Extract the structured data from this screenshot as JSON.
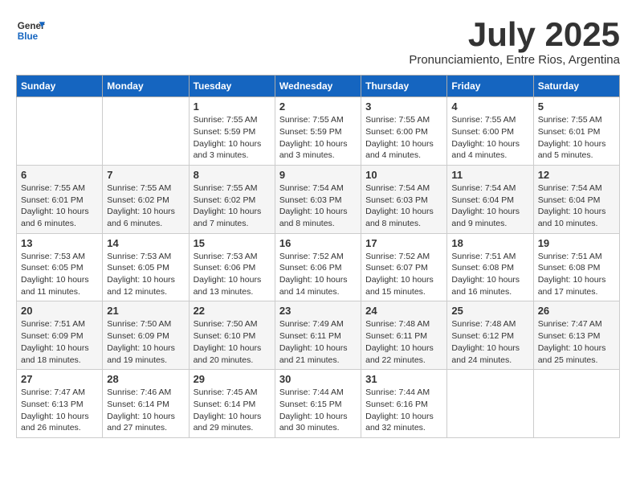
{
  "header": {
    "logo_line1": "General",
    "logo_line2": "Blue",
    "month_title": "July 2025",
    "subtitle": "Pronunciamiento, Entre Rios, Argentina"
  },
  "weekdays": [
    "Sunday",
    "Monday",
    "Tuesday",
    "Wednesday",
    "Thursday",
    "Friday",
    "Saturday"
  ],
  "weeks": [
    [
      {
        "day": "",
        "info": ""
      },
      {
        "day": "",
        "info": ""
      },
      {
        "day": "1",
        "info": "Sunrise: 7:55 AM\nSunset: 5:59 PM\nDaylight: 10 hours and 3 minutes."
      },
      {
        "day": "2",
        "info": "Sunrise: 7:55 AM\nSunset: 5:59 PM\nDaylight: 10 hours and 3 minutes."
      },
      {
        "day": "3",
        "info": "Sunrise: 7:55 AM\nSunset: 6:00 PM\nDaylight: 10 hours and 4 minutes."
      },
      {
        "day": "4",
        "info": "Sunrise: 7:55 AM\nSunset: 6:00 PM\nDaylight: 10 hours and 4 minutes."
      },
      {
        "day": "5",
        "info": "Sunrise: 7:55 AM\nSunset: 6:01 PM\nDaylight: 10 hours and 5 minutes."
      }
    ],
    [
      {
        "day": "6",
        "info": "Sunrise: 7:55 AM\nSunset: 6:01 PM\nDaylight: 10 hours and 6 minutes."
      },
      {
        "day": "7",
        "info": "Sunrise: 7:55 AM\nSunset: 6:02 PM\nDaylight: 10 hours and 6 minutes."
      },
      {
        "day": "8",
        "info": "Sunrise: 7:55 AM\nSunset: 6:02 PM\nDaylight: 10 hours and 7 minutes."
      },
      {
        "day": "9",
        "info": "Sunrise: 7:54 AM\nSunset: 6:03 PM\nDaylight: 10 hours and 8 minutes."
      },
      {
        "day": "10",
        "info": "Sunrise: 7:54 AM\nSunset: 6:03 PM\nDaylight: 10 hours and 8 minutes."
      },
      {
        "day": "11",
        "info": "Sunrise: 7:54 AM\nSunset: 6:04 PM\nDaylight: 10 hours and 9 minutes."
      },
      {
        "day": "12",
        "info": "Sunrise: 7:54 AM\nSunset: 6:04 PM\nDaylight: 10 hours and 10 minutes."
      }
    ],
    [
      {
        "day": "13",
        "info": "Sunrise: 7:53 AM\nSunset: 6:05 PM\nDaylight: 10 hours and 11 minutes."
      },
      {
        "day": "14",
        "info": "Sunrise: 7:53 AM\nSunset: 6:05 PM\nDaylight: 10 hours and 12 minutes."
      },
      {
        "day": "15",
        "info": "Sunrise: 7:53 AM\nSunset: 6:06 PM\nDaylight: 10 hours and 13 minutes."
      },
      {
        "day": "16",
        "info": "Sunrise: 7:52 AM\nSunset: 6:06 PM\nDaylight: 10 hours and 14 minutes."
      },
      {
        "day": "17",
        "info": "Sunrise: 7:52 AM\nSunset: 6:07 PM\nDaylight: 10 hours and 15 minutes."
      },
      {
        "day": "18",
        "info": "Sunrise: 7:51 AM\nSunset: 6:08 PM\nDaylight: 10 hours and 16 minutes."
      },
      {
        "day": "19",
        "info": "Sunrise: 7:51 AM\nSunset: 6:08 PM\nDaylight: 10 hours and 17 minutes."
      }
    ],
    [
      {
        "day": "20",
        "info": "Sunrise: 7:51 AM\nSunset: 6:09 PM\nDaylight: 10 hours and 18 minutes."
      },
      {
        "day": "21",
        "info": "Sunrise: 7:50 AM\nSunset: 6:09 PM\nDaylight: 10 hours and 19 minutes."
      },
      {
        "day": "22",
        "info": "Sunrise: 7:50 AM\nSunset: 6:10 PM\nDaylight: 10 hours and 20 minutes."
      },
      {
        "day": "23",
        "info": "Sunrise: 7:49 AM\nSunset: 6:11 PM\nDaylight: 10 hours and 21 minutes."
      },
      {
        "day": "24",
        "info": "Sunrise: 7:48 AM\nSunset: 6:11 PM\nDaylight: 10 hours and 22 minutes."
      },
      {
        "day": "25",
        "info": "Sunrise: 7:48 AM\nSunset: 6:12 PM\nDaylight: 10 hours and 24 minutes."
      },
      {
        "day": "26",
        "info": "Sunrise: 7:47 AM\nSunset: 6:13 PM\nDaylight: 10 hours and 25 minutes."
      }
    ],
    [
      {
        "day": "27",
        "info": "Sunrise: 7:47 AM\nSunset: 6:13 PM\nDaylight: 10 hours and 26 minutes."
      },
      {
        "day": "28",
        "info": "Sunrise: 7:46 AM\nSunset: 6:14 PM\nDaylight: 10 hours and 27 minutes."
      },
      {
        "day": "29",
        "info": "Sunrise: 7:45 AM\nSunset: 6:14 PM\nDaylight: 10 hours and 29 minutes."
      },
      {
        "day": "30",
        "info": "Sunrise: 7:44 AM\nSunset: 6:15 PM\nDaylight: 10 hours and 30 minutes."
      },
      {
        "day": "31",
        "info": "Sunrise: 7:44 AM\nSunset: 6:16 PM\nDaylight: 10 hours and 32 minutes."
      },
      {
        "day": "",
        "info": ""
      },
      {
        "day": "",
        "info": ""
      }
    ]
  ]
}
